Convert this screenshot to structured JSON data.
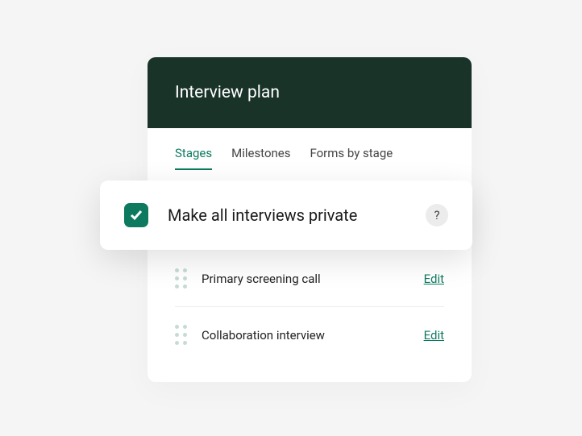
{
  "card": {
    "title": "Interview plan"
  },
  "tabs": [
    {
      "label": "Stages",
      "active": true
    },
    {
      "label": "Milestones",
      "active": false
    },
    {
      "label": "Forms by stage",
      "active": false
    }
  ],
  "stages": [
    {
      "label": "Primary screening call",
      "action": "Edit"
    },
    {
      "label": "Collaboration interview",
      "action": "Edit"
    }
  ],
  "overlay": {
    "label": "Make all interviews private",
    "help": "?"
  }
}
